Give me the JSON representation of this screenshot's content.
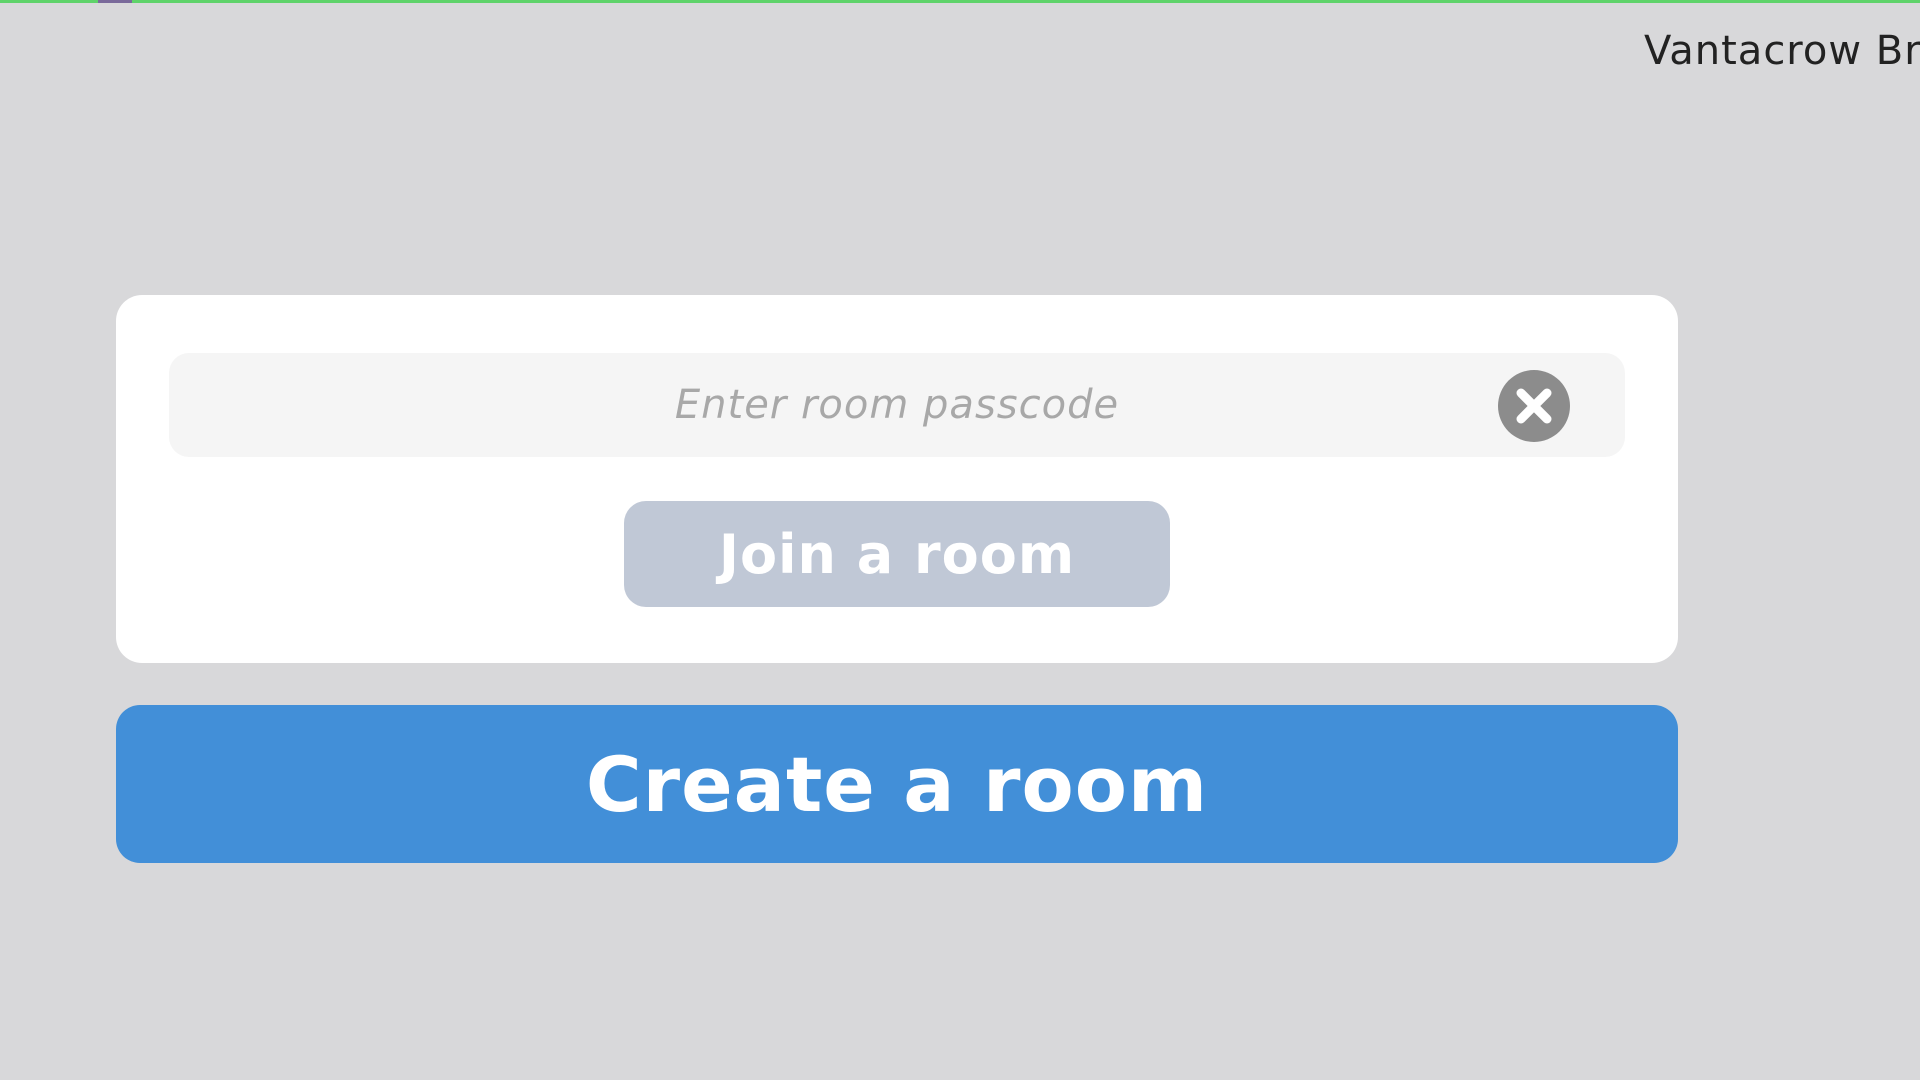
{
  "header": {
    "username": "Vantacrow Br"
  },
  "join_panel": {
    "passcode_placeholder": "Enter room passcode",
    "passcode_value": "",
    "clear_icon": "close-circle-icon",
    "join_label": "Join a room"
  },
  "create_label": "Create a room",
  "colors": {
    "background": "#d8d8da",
    "top_bar_accent": "#5fd36a",
    "card": "#ffffff",
    "input_bg": "#f5f5f5",
    "clear_icon": "#8c8c8c",
    "join_button_disabled": "#c0c8d6",
    "create_button": "#428fd8"
  }
}
